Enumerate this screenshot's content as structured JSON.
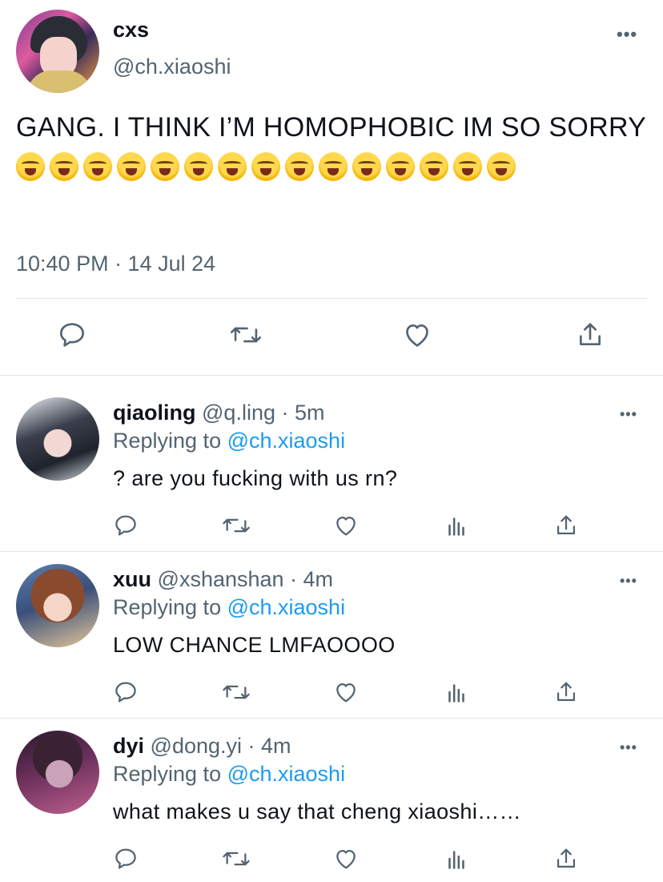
{
  "main_tweet": {
    "name": "cxs",
    "handle": "@ch.xiaoshi",
    "text": "GANG.  I THINK I’M HOMOPHOBIC IM SO SORRY",
    "emoji_count": 15,
    "emoji_icon": "loudly-crying-face",
    "timestamp": "10:40 PM · 14 Jul 24",
    "actions": [
      "reply-icon",
      "retweet-icon",
      "like-icon",
      "share-icon"
    ]
  },
  "replies": [
    {
      "name": "qiaoling",
      "meta": "@q.ling · 5m",
      "replying_prefix": "Replying to ",
      "replying_handle": "@ch.xiaoshi",
      "text": "? are you fucking with us rn?"
    },
    {
      "name": "xuu",
      "meta": "@xshanshan · 4m",
      "replying_prefix": "Replying to ",
      "replying_handle": "@ch.xiaoshi",
      "text": "LOW CHANCE LMFAOOOO"
    },
    {
      "name": "dyi",
      "meta": "@dong.yi · 4m",
      "replying_prefix": "Replying to ",
      "replying_handle": "@ch.xiaoshi",
      "text": "what makes u say that cheng xiaoshi……"
    }
  ],
  "colors": {
    "text": "#0f1419",
    "secondary": "#536471",
    "link": "#1d9bf0",
    "divider": "#e1e6ea"
  }
}
